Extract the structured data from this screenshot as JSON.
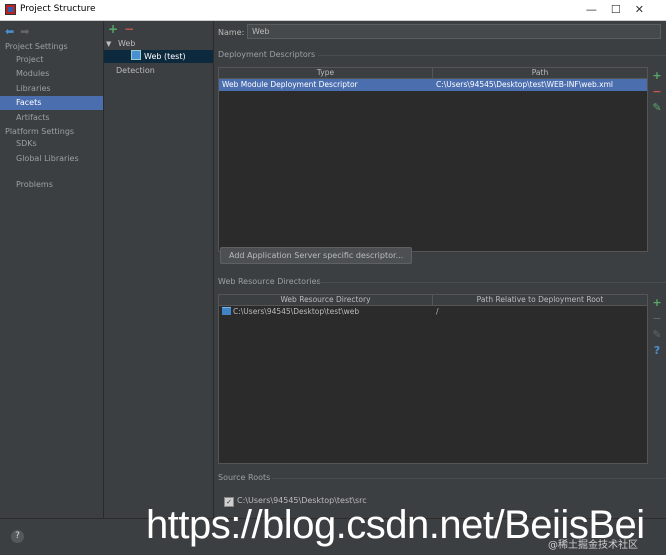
{
  "window": {
    "title": "Project Structure",
    "controls": [
      "—",
      "☐",
      "✕"
    ]
  },
  "nav": {
    "arrows": {
      "back": "⬅",
      "forward": "➡"
    },
    "project_settings_header": "Project Settings",
    "project_items": [
      "Project",
      "Modules",
      "Libraries",
      "Facets",
      "Artifacts"
    ],
    "platform_settings_header": "Platform Settings",
    "platform_items": [
      "SDKs",
      "Global Libraries"
    ],
    "problems": "Problems",
    "selected": "Facets"
  },
  "tree": {
    "add": "+",
    "remove": "−",
    "root": "Web",
    "root_arrow": "▼",
    "child": "Web (test)",
    "detection": "Detection"
  },
  "main": {
    "name_label": "Name:",
    "name_value": "Web",
    "deployment": {
      "title": "Deployment Descriptors",
      "columns": [
        "Type",
        "Path"
      ],
      "rows": [
        {
          "type": "Web Module Deployment Descriptor",
          "path": "C:\\Users\\94545\\Desktop\\test\\WEB-INF\\web.xml"
        }
      ],
      "add_server_button": "Add Application Server specific descriptor..."
    },
    "resources": {
      "title": "Web Resource Directories",
      "columns": [
        "Web Resource Directory",
        "Path Relative to Deployment Root"
      ],
      "rows": [
        {
          "dir": "C:\\Users\\94545\\Desktop\\test\\web",
          "path": "/"
        }
      ]
    },
    "source_roots": {
      "title": "Source Roots",
      "items": [
        {
          "checked": true,
          "path": "C:\\Users\\94545\\Desktop\\test\\src"
        }
      ]
    },
    "tools": {
      "add": "+",
      "remove": "−",
      "edit": "✎",
      "help": "?"
    }
  },
  "bottom": {
    "help": "?",
    "watermark": "https://blog.csdn.net/BeiisBei",
    "watermark_sub": "@稀土掘金技术社区"
  },
  "colors": {
    "selection": "#4b6eaf",
    "add": "#59a869",
    "remove": "#c75450",
    "background": "#3c3f41"
  }
}
